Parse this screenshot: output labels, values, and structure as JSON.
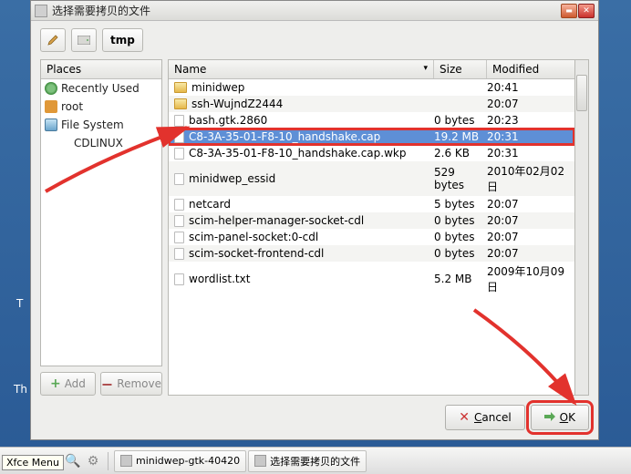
{
  "window": {
    "title": "选择需要拷贝的文件",
    "path_segment": "tmp"
  },
  "places": {
    "header": "Places",
    "recent": "Recently Used",
    "root": "root",
    "fs": "File System",
    "cd": "CDLINUX"
  },
  "buttons": {
    "add": "Add",
    "remove": "Remove",
    "cancel": "Cancel",
    "ok": "OK"
  },
  "columns": {
    "name": "Name",
    "size": "Size",
    "modified": "Modified"
  },
  "files": [
    {
      "name": "minidwep",
      "size": "",
      "modified": "20:41",
      "type": "folder"
    },
    {
      "name": "ssh-WujndZ2444",
      "size": "",
      "modified": "20:07",
      "type": "folder"
    },
    {
      "name": "bash.gtk.2860",
      "size": "0 bytes",
      "modified": "20:23",
      "type": "file"
    },
    {
      "name": "C8-3A-35-01-F8-10_handshake.cap",
      "size": "19.2 MB",
      "modified": "20:31",
      "type": "file",
      "selected": true,
      "highlighted": true
    },
    {
      "name": "C8-3A-35-01-F8-10_handshake.cap.wkp",
      "size": "2.6 KB",
      "modified": "20:31",
      "type": "file"
    },
    {
      "name": "minidwep_essid",
      "size": "529 bytes",
      "modified": "2010年02月02日",
      "type": "file"
    },
    {
      "name": "netcard",
      "size": "5 bytes",
      "modified": "20:07",
      "type": "file"
    },
    {
      "name": "scim-helper-manager-socket-cdl",
      "size": "0 bytes",
      "modified": "20:07",
      "type": "file"
    },
    {
      "name": "scim-panel-socket:0-cdl",
      "size": "0 bytes",
      "modified": "20:07",
      "type": "file"
    },
    {
      "name": "scim-socket-frontend-cdl",
      "size": "0 bytes",
      "modified": "20:07",
      "type": "file"
    },
    {
      "name": "wordlist.txt",
      "size": "5.2 MB",
      "modified": "2009年10月09日",
      "type": "file"
    }
  ],
  "taskbar": {
    "xfce_tooltip": "Xfce Menu",
    "task1": "minidwep-gtk-40420",
    "task2": "选择需要拷贝的文件"
  },
  "side": {
    "t1": "T",
    "t2": "Th"
  }
}
